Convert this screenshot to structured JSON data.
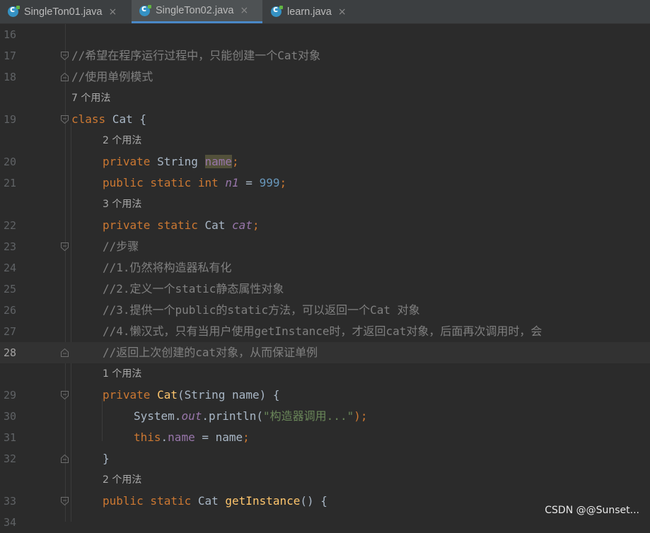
{
  "tabs": [
    {
      "name": "SingleTon01.java",
      "active": false,
      "close": "×"
    },
    {
      "name": "SingleTon02.java",
      "active": true,
      "close": "×"
    },
    {
      "name": "learn.java",
      "active": false,
      "close": "×"
    }
  ],
  "colors": {
    "background": "#2b2b2b",
    "keyword": "#cc7832",
    "comment": "#808080",
    "number": "#6897bb",
    "string": "#6a8759",
    "field": "#9876aa",
    "method": "#ffc66d",
    "text": "#a9b7c6",
    "tab_underline": "#4a88c7"
  },
  "lines": [
    {
      "type": "code",
      "num": "16",
      "indent": 0,
      "tokens": []
    },
    {
      "type": "code",
      "num": "17",
      "indent": 0,
      "fold": "open",
      "tokens": [
        {
          "t": "//希望在程序运行过程中，只能创建一个Cat对象",
          "c": "cm"
        }
      ]
    },
    {
      "type": "code",
      "num": "18",
      "indent": 0,
      "fold": "close",
      "tokens": [
        {
          "t": "//使用单例模式",
          "c": "cm"
        }
      ]
    },
    {
      "type": "hint",
      "indent": 0,
      "text": "7 个用法"
    },
    {
      "type": "code",
      "num": "19",
      "indent": 0,
      "fold": "open",
      "tokens": [
        {
          "t": "class",
          "c": "kw"
        },
        {
          "t": " Cat {",
          "c": ""
        }
      ]
    },
    {
      "type": "hint",
      "indent": 1,
      "text": "2 个用法"
    },
    {
      "type": "code",
      "num": "20",
      "indent": 1,
      "tokens": [
        {
          "t": "private",
          "c": "kw"
        },
        {
          "t": " String ",
          "c": ""
        },
        {
          "t": "name",
          "c": "fld hl"
        },
        {
          "t": ";",
          "c": "kw"
        }
      ]
    },
    {
      "type": "code",
      "num": "21",
      "indent": 1,
      "tokens": [
        {
          "t": "public static int",
          "c": "kw"
        },
        {
          "t": " ",
          "c": ""
        },
        {
          "t": "n1",
          "c": "sfi"
        },
        {
          "t": " = ",
          "c": ""
        },
        {
          "t": "999",
          "c": "num"
        },
        {
          "t": ";",
          "c": "kw"
        }
      ]
    },
    {
      "type": "hint",
      "indent": 1,
      "text": "3 个用法"
    },
    {
      "type": "code",
      "num": "22",
      "indent": 1,
      "tokens": [
        {
          "t": "private static",
          "c": "kw"
        },
        {
          "t": " Cat ",
          "c": ""
        },
        {
          "t": "cat",
          "c": "sfi"
        },
        {
          "t": ";",
          "c": "kw"
        }
      ]
    },
    {
      "type": "code",
      "num": "23",
      "indent": 1,
      "fold": "open",
      "tokens": [
        {
          "t": "//步骤",
          "c": "cm"
        }
      ]
    },
    {
      "type": "code",
      "num": "24",
      "indent": 1,
      "tokens": [
        {
          "t": "//1.仍然将构造器私有化",
          "c": "cm"
        }
      ]
    },
    {
      "type": "code",
      "num": "25",
      "indent": 1,
      "tokens": [
        {
          "t": "//2.定义一个static静态属性对象",
          "c": "cm"
        }
      ]
    },
    {
      "type": "code",
      "num": "26",
      "indent": 1,
      "tokens": [
        {
          "t": "//3.提供一个public的static方法，可以返回一个Cat 对象",
          "c": "cm"
        }
      ]
    },
    {
      "type": "code",
      "num": "27",
      "indent": 1,
      "tokens": [
        {
          "t": "//4.懒汉式，只有当用户使用getInstance时，才返回cat对象，后面再次调用时，会",
          "c": "cm"
        }
      ]
    },
    {
      "type": "code",
      "num": "28",
      "indent": 1,
      "fold": "close",
      "current": true,
      "tokens": [
        {
          "t": "//返回上次创建的cat对象，从而保证单例",
          "c": "cm"
        }
      ]
    },
    {
      "type": "hint",
      "indent": 1,
      "text": "1 个用法"
    },
    {
      "type": "code",
      "num": "29",
      "indent": 1,
      "fold": "open",
      "tokens": [
        {
          "t": "private",
          "c": "kw"
        },
        {
          "t": " ",
          "c": ""
        },
        {
          "t": "Cat",
          "c": "mth"
        },
        {
          "t": "(String name) {",
          "c": ""
        }
      ]
    },
    {
      "type": "code",
      "num": "30",
      "indent": 2,
      "tokens": [
        {
          "t": "System.",
          "c": ""
        },
        {
          "t": "out",
          "c": "sfi"
        },
        {
          "t": ".println(",
          "c": ""
        },
        {
          "t": "\"构造器调用...\"",
          "c": "str"
        },
        {
          "t": ");",
          "c": "kw"
        }
      ]
    },
    {
      "type": "code",
      "num": "31",
      "indent": 2,
      "tokens": [
        {
          "t": "this",
          "c": "kw"
        },
        {
          "t": ".",
          "c": ""
        },
        {
          "t": "name",
          "c": "fld"
        },
        {
          "t": " = name",
          "c": ""
        },
        {
          "t": ";",
          "c": "kw"
        }
      ]
    },
    {
      "type": "code",
      "num": "32",
      "indent": 1,
      "fold": "close",
      "tokens": [
        {
          "t": "}",
          "c": ""
        }
      ]
    },
    {
      "type": "hint",
      "indent": 1,
      "text": "2 个用法"
    },
    {
      "type": "code",
      "num": "33",
      "indent": 1,
      "fold": "open",
      "tokens": [
        {
          "t": "public static",
          "c": "kw"
        },
        {
          "t": " Cat ",
          "c": ""
        },
        {
          "t": "getInstance",
          "c": "mth"
        },
        {
          "t": "() {",
          "c": ""
        }
      ]
    },
    {
      "type": "code",
      "num": "34",
      "indent": 1,
      "tokens": []
    }
  ],
  "watermark": "CSDN @@Sunset..."
}
